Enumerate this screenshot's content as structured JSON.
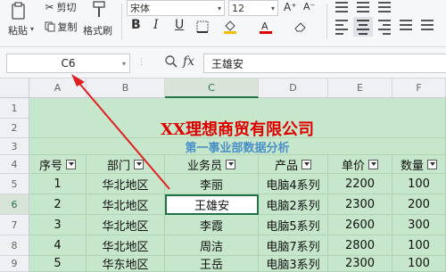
{
  "ribbon": {
    "cut_label": "剪切",
    "paste_label": "粘贴",
    "copy_label": "复制",
    "format_painter_label": "格式刷",
    "font_name": "宋体",
    "font_size": "12",
    "bold": "B",
    "italic": "I",
    "underline": "U",
    "grow_font": "A⁺",
    "shrink_font": "A⁻"
  },
  "formula_bar": {
    "name_box": "C6",
    "fx_label": "fx",
    "content": "王雄安"
  },
  "columns": [
    "A",
    "B",
    "C",
    "D",
    "E",
    "F"
  ],
  "selected_column": "C",
  "selected_row": "6",
  "rows": [
    "1",
    "2",
    "3",
    "4",
    "5",
    "6",
    "7",
    "8",
    "9"
  ],
  "sheet": {
    "title": "XX理想商贸有限公司",
    "title_color": "#e00000",
    "subtitle": "第一事业部数据分析",
    "subtitle_color": "#4a90c8",
    "headers": [
      "序号",
      "部门",
      "业务员",
      "产品",
      "单价",
      "数量"
    ],
    "data": [
      [
        "1",
        "华北地区",
        "李丽",
        "电脑4系列",
        "2200",
        "100"
      ],
      [
        "2",
        "华北地区",
        "王雄安",
        "电脑2系列",
        "2300",
        "200"
      ],
      [
        "3",
        "华北地区",
        "李霞",
        "电脑5系列",
        "2600",
        "300"
      ],
      [
        "4",
        "华北地区",
        "周洁",
        "电脑7系列",
        "2800",
        "100"
      ],
      [
        "5",
        "华东地区",
        "王岳",
        "电脑3系列",
        "2300",
        "100"
      ]
    ]
  },
  "colors": {
    "cell_fill": "#c6e7cb",
    "accent": "#217346",
    "arrow": "#e02020"
  }
}
